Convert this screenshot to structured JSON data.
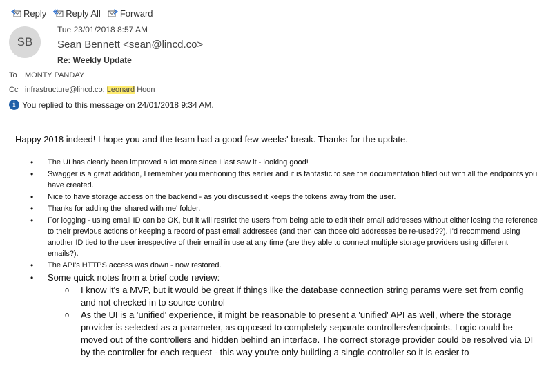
{
  "toolbar": {
    "reply": "Reply",
    "reply_all": "Reply All",
    "forward": "Forward"
  },
  "message": {
    "avatar_initials": "SB",
    "date": "Tue 23/01/2018 8:57 AM",
    "sender": "Sean Bennett <sean@lincd.co>",
    "subject": "Re: Weekly Update",
    "to_label": "To",
    "to": "MONTY PANDAY",
    "cc_label": "Cc",
    "cc_pre": "infrastructure@lincd.co; ",
    "cc_highlight": "Leonard",
    "cc_post": " Hoon",
    "info": "You replied to this message on 24/01/2018 9:34 AM."
  },
  "body": {
    "greeting": "Happy 2018 indeed! I hope you and the team had a good few weeks' break. Thanks for the update.",
    "bullets": [
      "The UI has clearly been improved a lot more since I last saw it - looking good!",
      "Swagger is a great addition, I remember you mentioning this earlier and it is fantastic to see the documentation filled out with all the endpoints you have created.",
      "Nice to have storage access on the backend - as you discussed it keeps the tokens away from the user.",
      "Thanks for adding the 'shared with me' folder.",
      "For logging - using email ID can be OK, but it will restrict the users from being able to edit their email addresses without either losing the reference to their previous actions or keeping a record of past email addresses (and then can those old addresses be re-used??). I'd recommend using another ID tied to the user irrespective of their email in use at any time (are they able to connect multiple storage providers using different emails?).",
      "The API's HTTPS access was down - now restored.",
      "Some quick notes from a brief code review:"
    ],
    "sub_bullets": [
      "I know it's a MVP, but it would be great if things like the database connection string params were set from config and not checked in to source control",
      "As the UI is a 'unified' experience, it might be reasonable to present a 'unified' API as well, where the storage provider is selected as a parameter, as opposed to completely separate controllers/endpoints. Logic could be moved out of the controllers and hidden behind an interface. The correct storage provider could be resolved via DI by the controller for each request - this way you're only building a single controller so it is easier to"
    ]
  }
}
